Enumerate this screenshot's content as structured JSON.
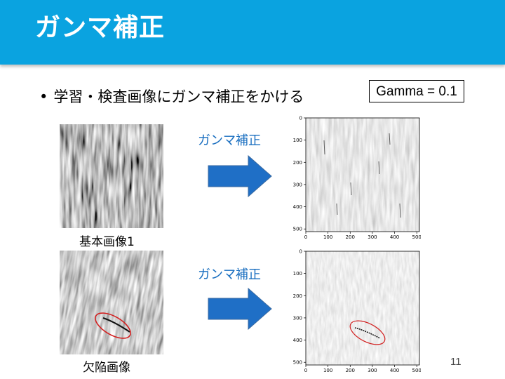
{
  "slide": {
    "title": "ガンマ補正",
    "bullet_marker": "•",
    "bullet_text": "学習・検査画像にガンマ補正をかける",
    "gamma_label": "Gamma = 0.1",
    "arrow_label_1": "ガンマ補正",
    "arrow_label_2": "ガンマ補正",
    "caption_base": "基本画像1",
    "caption_defect": "欠陥画像",
    "page_number": "11"
  },
  "colors": {
    "header": "#0aa3e0",
    "arrow": "#1f6fc6",
    "label_blue": "#1a6fc0",
    "ellipse": "#d22020"
  },
  "chart_data": [
    {
      "type": "heatmap",
      "title": "",
      "x_ticks": [
        "0",
        "100",
        "200",
        "300",
        "400",
        "500"
      ],
      "y_ticks": [
        "0",
        "100",
        "200",
        "300",
        "400",
        "500"
      ],
      "xlim": [
        0,
        512
      ],
      "ylim": [
        0,
        512
      ]
    },
    {
      "type": "heatmap",
      "title": "",
      "x_ticks": [
        "0",
        "100",
        "200",
        "300",
        "400",
        "500"
      ],
      "y_ticks": [
        "0",
        "100",
        "200",
        "300",
        "400",
        "500"
      ],
      "xlim": [
        0,
        512
      ],
      "ylim": [
        0,
        512
      ],
      "highlight": {
        "shape": "ellipse",
        "center": [
          280,
          360
        ],
        "color": "red"
      }
    }
  ]
}
